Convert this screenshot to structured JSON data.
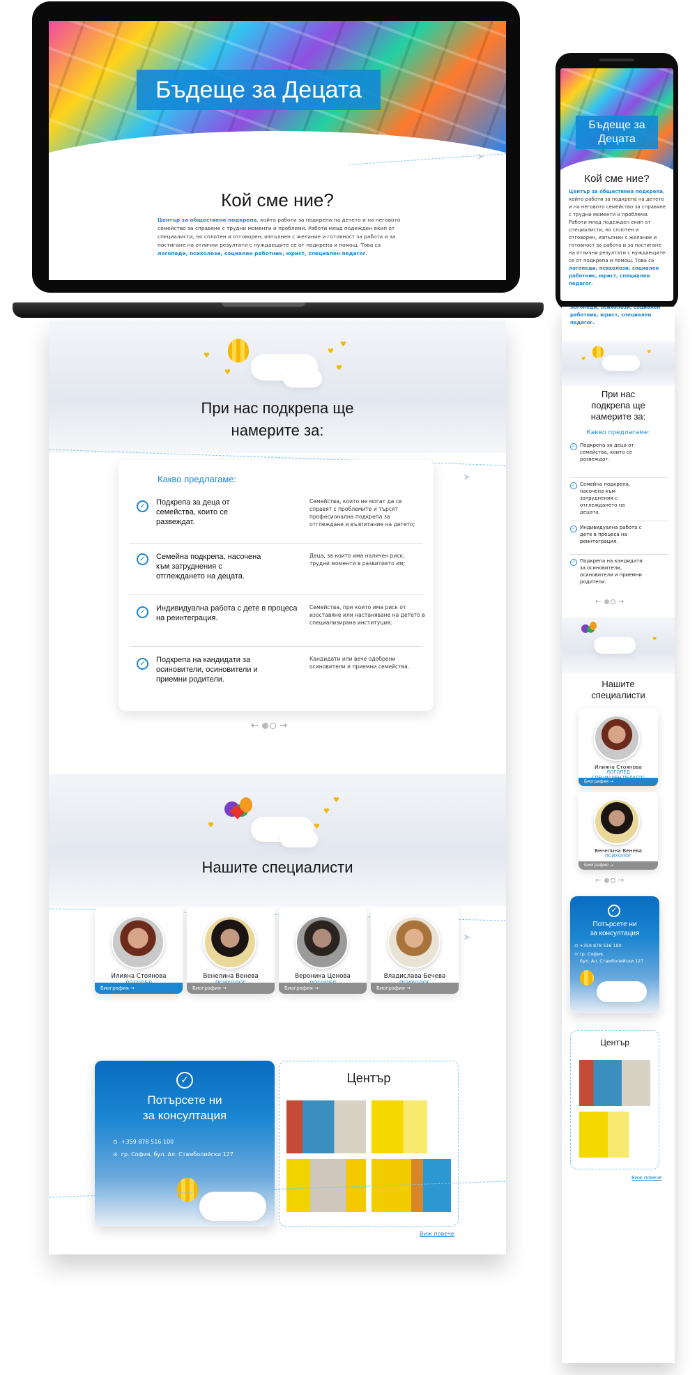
{
  "hero": {
    "title": "Бъдеще за Децата",
    "title_mobile_line1": "Бъдеще за",
    "title_mobile_line2": "Децата"
  },
  "about": {
    "heading": "Кой сме ние?",
    "highlight1": "Център за обществена подкрепа",
    "text1": ", който работи за подкрепа на детето и на неговото семейство за справяне с трудни моменти и проблеми. Работи млад подежден екип от специалисти, но сплотен и отговорен, изпълнен с желание и готовност за работа и за постигане на отлични резултати с нуждаещите се от подкрепа и помощ. Това са ",
    "highlight2": "логопеди, психолози, социален работник, юрист, специален педагог."
  },
  "offers": {
    "heading_line1": "При нас подкрепа ще",
    "heading_line2": "намерите за:",
    "mobile_heading_1": "При нас",
    "mobile_heading_2": "подкрепа ще",
    "mobile_heading_3": "намерите за:",
    "card_title": "Какво предлагаме:",
    "items": [
      {
        "title": "Подкрепа за деца от семейства, които се развеждат.",
        "desc": "Семейства, които не могат да се справят с проблемите и търсят професионална подкрепа за отглеждане и възпитание на детето;"
      },
      {
        "title": "Семейна подкрепа, насочена към затруднения с отглеждането на децата.",
        "desc": "Деца, за които има наличен риск, трудни моменти в развитието им;"
      },
      {
        "title": "Индивидуална работа с дете в процеса на реинтеграция.",
        "desc": "Семейства, при които има риск от изоставяне или настаняване на детето в специализирана институция;"
      },
      {
        "title": "Подкрепа на кандидати за осиновители, осиновители и приемни родители.",
        "desc": "Кандидати или вече одобрени осиновители и приемни семейства."
      }
    ],
    "mobile_items": [
      "Подкрепа за деца от семейства, които се развеждат.",
      "Семейна подкрепа, насочена към затруднения с отглеждането на децата.",
      "Индивидуална работа с дете в процеса на реинтеграция.",
      "Подкрепа на кандидати за осиновители, осиновители и приемни родители."
    ]
  },
  "specialists": {
    "heading": "Нашите специалисти",
    "mobile_heading_1": "Нашите",
    "mobile_heading_2": "специалисти",
    "bio_label": "Биография",
    "items": [
      {
        "name": "Илияна Стоянова",
        "role1": "Логопед",
        "role2": "Специален педагог"
      },
      {
        "name": "Венелина Венева",
        "role1": "Психолог",
        "role2": ""
      },
      {
        "name": "Вероника Ценова",
        "role1": "Логопед",
        "role2": ""
      },
      {
        "name": "Владислава Бечева",
        "role1": "Психолог",
        "role2": ""
      }
    ]
  },
  "consult": {
    "title_line1": "Потърсете ни",
    "title_line2": "за консултация",
    "phone": "+359 878 516 100",
    "address": "гр. София, бул. Ал. Стамболийски 127",
    "address_m1": "гр. София,",
    "address_m2": "бул. Ал. Стамболийски 127"
  },
  "center": {
    "heading": "Център",
    "more": "Виж повече"
  },
  "colors": {
    "accent": "#1b86d1",
    "heart": "#f6b800"
  }
}
